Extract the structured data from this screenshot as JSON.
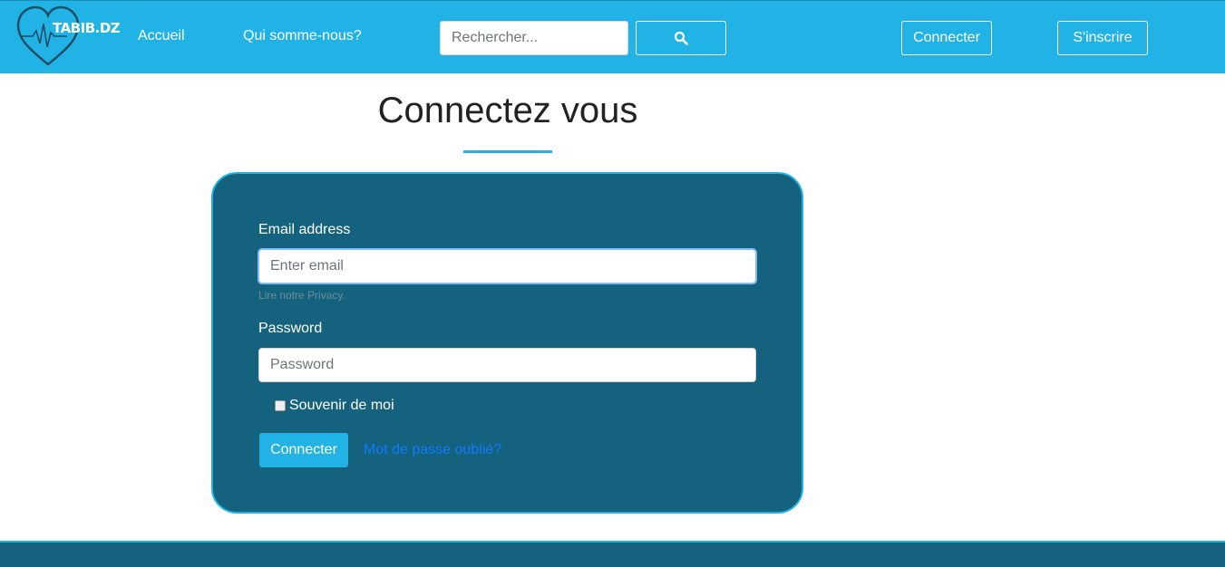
{
  "navbar": {
    "logo_text": "TABIB.DZ",
    "links": [
      "Accueil",
      "Qui somme-nous?"
    ],
    "search": {
      "placeholder": "Rechercher...",
      "value": ""
    },
    "login_label": "Connecter",
    "signup_label": "S'inscrire",
    "colors": {
      "bar": "#22b3e6",
      "text": "#ffffff"
    }
  },
  "page": {
    "title": "Connectez vous"
  },
  "form": {
    "email_label": "Email address",
    "email_placeholder": "Enter email",
    "email_help": "Lire notre Privacy.",
    "password_label": "Password",
    "password_placeholder": "Password",
    "remember_label": "Souvenir de moi",
    "remember_checked": false,
    "submit_label": "Connecter",
    "forgot_label": "Mot de passe oublié?",
    "colors": {
      "card": "#14627d",
      "accent": "#22b3e6",
      "link": "#0d7bff"
    }
  },
  "icons": {
    "logo": "heart-pulse-icon",
    "search": "search-icon"
  }
}
